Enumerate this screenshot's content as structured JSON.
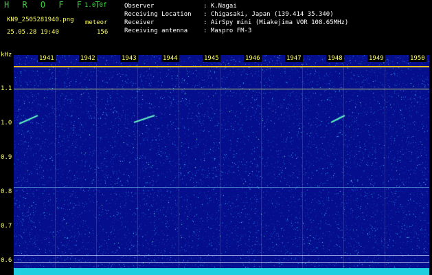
{
  "header": {
    "title": "H R O F F T",
    "version": "1.0.0f",
    "file_name": "KN9_2505281940.png",
    "meteor_label": "meteor",
    "timestamp": "25.05.28 19:40",
    "meteor_count": "156"
  },
  "info": [
    {
      "label": "Observer",
      "value": ": K.Nagai"
    },
    {
      "label": "Receiving Location",
      "value": ": Chigasaki, Japan (139.414 35.340)"
    },
    {
      "label": "Receiver",
      "value": ": AirSpy mini (Miakejima VOR 108.65MHz)"
    },
    {
      "label": "Receiving antenna",
      "value": ": Maspro FM-3"
    }
  ],
  "axis": {
    "unit": "kHz",
    "y_ticks": [
      "1.1",
      "1.0",
      "0.9",
      "0.8",
      "0.7",
      "0.6"
    ],
    "time_ticks": [
      "1941",
      "1942",
      "1943",
      "1944",
      "1945",
      "1946",
      "1947",
      "1948",
      "1949",
      "1950"
    ]
  },
  "colors": {
    "background": "#000000",
    "plot": "#050e8c",
    "title_green": "#3cd23c",
    "label_yellow": "#ffff60"
  }
}
